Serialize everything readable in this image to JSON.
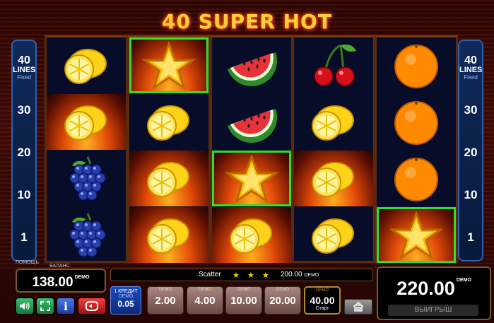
{
  "game": {
    "title": "40 SUPER HOT"
  },
  "lines_panel": {
    "count": "40",
    "word": "LINES",
    "fixed": "Fixed",
    "numbers": [
      "30",
      "20",
      "10",
      "1"
    ]
  },
  "reels": [
    [
      "lemon",
      "lemon",
      "grapes",
      "grapes"
    ],
    [
      "star",
      "lemon",
      "lemon",
      "lemon"
    ],
    [
      "watermelon",
      "watermelon",
      "star",
      "lemon"
    ],
    [
      "cherries",
      "lemon",
      "lemon",
      "lemon"
    ],
    [
      "orange",
      "orange",
      "orange",
      "star"
    ]
  ],
  "highlighted_cells": [
    "reel1-row0",
    "reel2-row2",
    "reel4-row3"
  ],
  "balance": {
    "label_top": "ПОМОЩЬ",
    "label": "БАЛАНС",
    "value": "138.00",
    "unit": "DEMO"
  },
  "info_bar": {
    "symbol": "Scatter",
    "stars": [
      "★",
      "★",
      "★"
    ],
    "amount": "200.00",
    "unit": "DEMO"
  },
  "win": {
    "value": "220.00",
    "unit": "DEMO",
    "label": "ВЫИГРЫШ"
  },
  "credit": {
    "line1": "1 КРЕДИТ",
    "line2": "DEMO",
    "value": "0.05"
  },
  "bets": [
    {
      "demo": "DEMO",
      "value": "2.00"
    },
    {
      "demo": "DEMO",
      "value": "4.00"
    },
    {
      "demo": "DEMO",
      "value": "10.00"
    },
    {
      "demo": "DEMO",
      "value": "20.00"
    }
  ],
  "active_bet": {
    "demo": "DEMO",
    "value": "40.00",
    "label": "Старт"
  },
  "colors": {
    "highlight": "#2fe02a",
    "title": "#ffcf3a",
    "reel_bg": "#070d28"
  },
  "controls": {
    "sound_icon": "speaker-icon",
    "fullscreen_icon": "fullscreen-icon",
    "info_icon": "info-icon",
    "autoplay_icon": "autoplay-icon",
    "home_icon": "home-icon"
  }
}
